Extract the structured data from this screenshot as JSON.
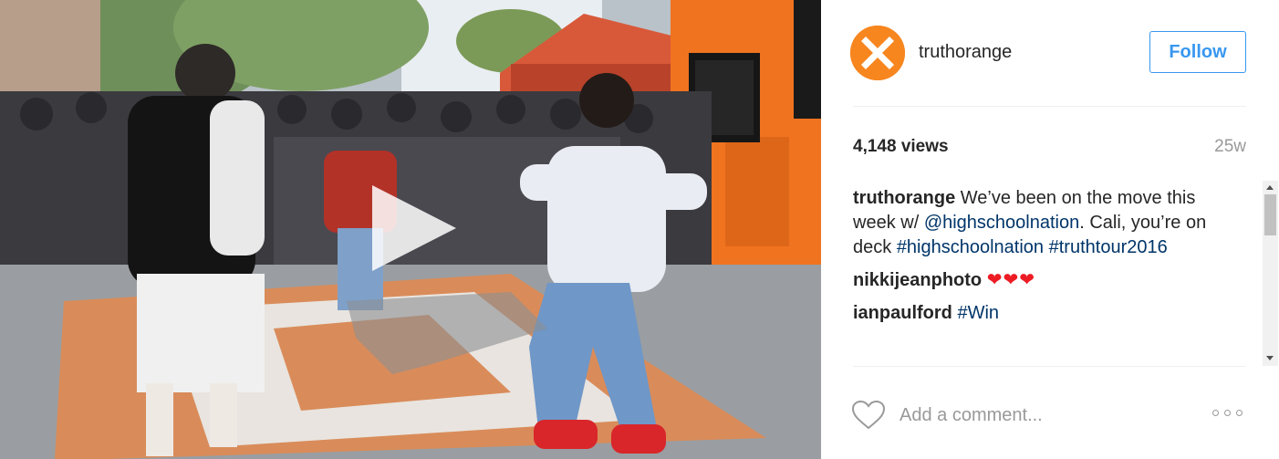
{
  "post": {
    "username": "truthorange",
    "follow_label": "Follow",
    "views": "4,148 views",
    "age": "25w",
    "comment_placeholder": "Add a comment...",
    "avatar_icon": "x-logo-icon",
    "more_icon": "more-options-icon",
    "like_icon": "heart-outline-icon",
    "play_icon": "play-icon"
  },
  "caption": {
    "user": "truthorange",
    "text_1": " We’ve been on the move this week w/ ",
    "mention": "@highschoolnation",
    "text_2": ". Cali, you’re on deck ",
    "tag_1": "#highschoolnation",
    "tag_2": "#truthtour2016"
  },
  "comments": [
    {
      "user": "nikkijeanphoto",
      "text": "❤❤❤"
    },
    {
      "user": "ianpaulford",
      "text": "#Win"
    }
  ],
  "colors": {
    "accent_blue": "#3897f0",
    "hashtag_blue": "#003569",
    "brand_orange": "#f7861f",
    "heart_red": "#ed1c24"
  }
}
